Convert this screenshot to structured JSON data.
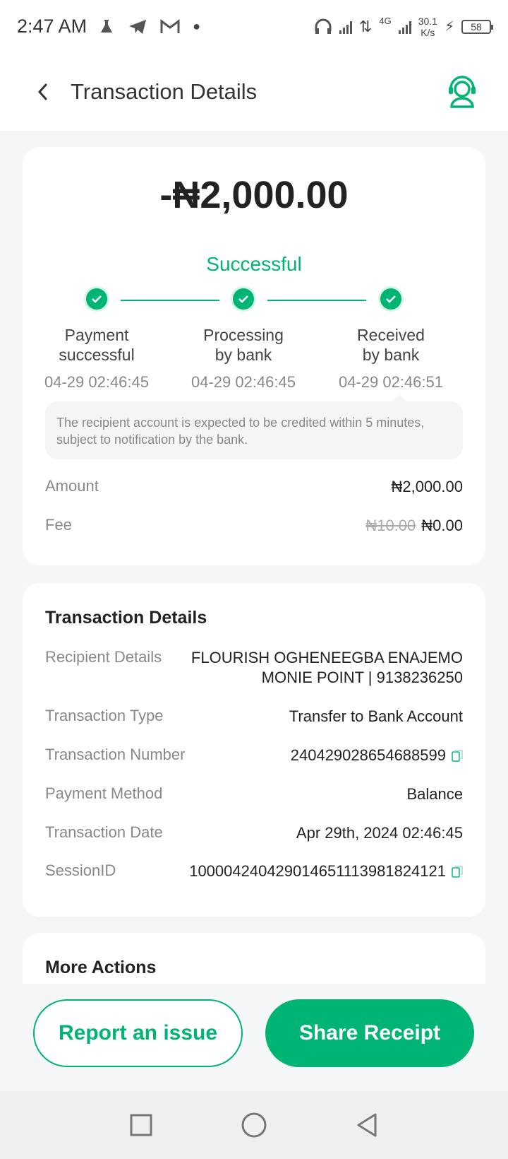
{
  "status_bar": {
    "time": "2:47 AM",
    "network_type": "4G",
    "speed_value": "30.1",
    "speed_unit": "K/s",
    "battery": "58"
  },
  "header": {
    "title": "Transaction Details",
    "back_icon": "chevron-left-icon",
    "support_icon": "headset-icon"
  },
  "summary": {
    "amount": "-₦2,000.00",
    "status": "Successful",
    "steps": [
      {
        "label_line1": "Payment",
        "label_line2": "successful",
        "time": "04-29 02:46:45"
      },
      {
        "label_line1": "Processing",
        "label_line2": "by bank",
        "time": "04-29 02:46:45"
      },
      {
        "label_line1": "Received",
        "label_line2": "by bank",
        "time": "04-29 02:46:51"
      }
    ],
    "notice": "The recipient account is expected to be credited within 5 minutes, subject to notification by the bank.",
    "amount_label": "Amount",
    "amount_value": "₦2,000.00",
    "fee_label": "Fee",
    "fee_original": "₦10.00",
    "fee_value": "₦0.00"
  },
  "details": {
    "title": "Transaction Details",
    "recipient_label": "Recipient Details",
    "recipient_name": "FLOURISH OGHENEEGBA ENAJEMO",
    "recipient_bank": "MONIE POINT | 9138236250",
    "type_label": "Transaction Type",
    "type_value": "Transfer to Bank Account",
    "number_label": "Transaction Number",
    "number_value": "240429028654688599",
    "method_label": "Payment Method",
    "method_value": "Balance",
    "date_label": "Transaction Date",
    "date_value": "Apr 29th, 2024 02:46:45",
    "session_label": "SessionID",
    "session_value": "100004240429014651113981824121"
  },
  "more_actions": {
    "title": "More Actions"
  },
  "actions": {
    "report_label": "Report an issue",
    "share_label": "Share Receipt"
  },
  "colors": {
    "accent": "#00b574"
  }
}
